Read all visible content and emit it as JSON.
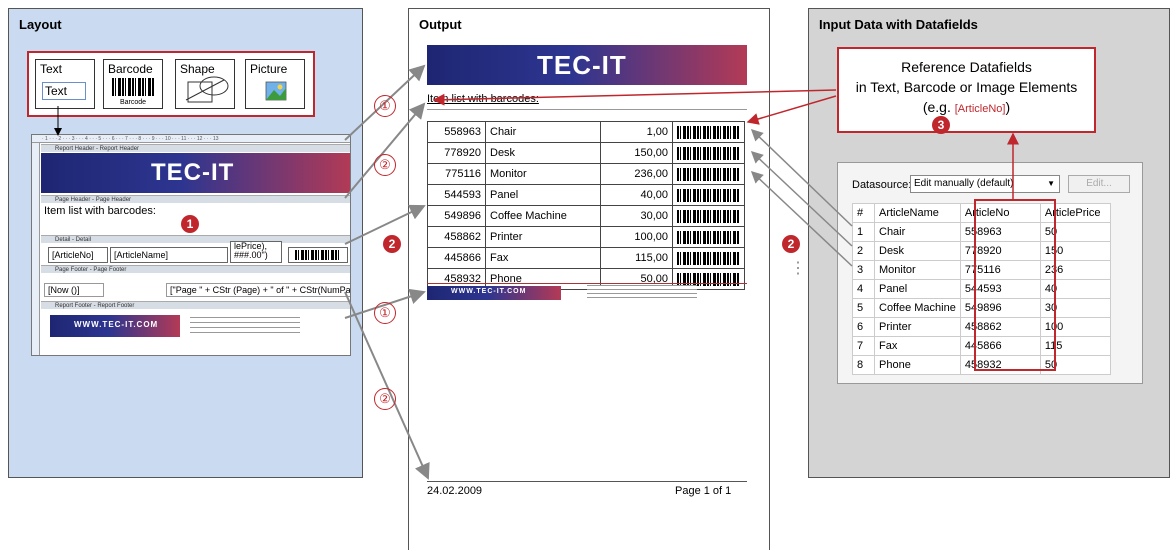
{
  "layout": {
    "title": "Layout",
    "tools": [
      {
        "label": "Text",
        "sample": "Text"
      },
      {
        "label": "Barcode",
        "sample": "Barcode"
      },
      {
        "label": "Shape"
      },
      {
        "label": "Picture"
      }
    ],
    "designer": {
      "ruler_text": "· 1 · · · 2 · · · 3 · · · 4 · · · 5 · · · 6 · · · 7 · · · 8 · · · 9 · · · 10 · · · 11 · · · 12 · · · 13",
      "sections": [
        "Report Header - Report Header",
        "Page Header - Page Header",
        "Detail - Detail",
        "Page Footer - Page Footer",
        "Report Footer - Report Footer"
      ],
      "banner_text": "TEC-IT",
      "heading": "Item list with barcodes:",
      "detail_fields": {
        "article_no": "[ArticleNo]",
        "article_name": "[ArticleName]",
        "price": "lePrice), ###.00\")"
      },
      "footer_left": "[Now ()]",
      "footer_right": "[\"Page \" + CStr (Page) + \" of \" + CStr(NumPages)]",
      "report_footer_text": "WWW.TEC-IT.COM"
    }
  },
  "output": {
    "title": "Output",
    "banner_text": "TEC-IT",
    "heading": "Item list with barcodes:",
    "rows": [
      {
        "no": "558963",
        "name": "Chair",
        "price": "1,00"
      },
      {
        "no": "778920",
        "name": "Desk",
        "price": "150,00"
      },
      {
        "no": "775116",
        "name": "Monitor",
        "price": "236,00"
      },
      {
        "no": "544593",
        "name": "Panel",
        "price": "40,00"
      },
      {
        "no": "549896",
        "name": "Coffee Machine",
        "price": "30,00"
      },
      {
        "no": "458862",
        "name": "Printer",
        "price": "100,00"
      },
      {
        "no": "445866",
        "name": "Fax",
        "price": "115,00"
      },
      {
        "no": "458932",
        "name": "Phone",
        "price": "50,00"
      }
    ],
    "footer_banner_text": "WWW.TEC-IT.COM",
    "date": "24.02.2009",
    "page": "Page 1 of 1"
  },
  "input": {
    "title": "Input Data with Datafields",
    "callout_line1": "Reference Datafields",
    "callout_line2": "in Text, Barcode or Image Elements",
    "callout_line3_pre": "(e.g. ",
    "callout_example": "[ArticleNo]",
    "callout_line3_post": ")",
    "datasource_label": "Datasource:",
    "datasource_value": "Edit manually (default)",
    "edit_button": "Edit...",
    "columns": [
      "#",
      "ArticleName",
      "ArticleNo",
      "ArticlePrice"
    ],
    "rows": [
      [
        "1",
        "Chair",
        "558963",
        "50"
      ],
      [
        "2",
        "Desk",
        "778920",
        "150"
      ],
      [
        "3",
        "Monitor",
        "775116",
        "236"
      ],
      [
        "4",
        "Panel",
        "544593",
        "40"
      ],
      [
        "5",
        "Coffee Machine",
        "549896",
        "30"
      ],
      [
        "6",
        "Printer",
        "458862",
        "100"
      ],
      [
        "7",
        "Fax",
        "445866",
        "115"
      ],
      [
        "8",
        "Phone",
        "458932",
        "50"
      ]
    ]
  },
  "markers": {
    "one": "1",
    "two": "2",
    "three": "3",
    "step1": "①",
    "step2": "②",
    "ellipsis": "⋮"
  },
  "colors": {
    "accent": "#c0272d",
    "layout_bg": "#c9daf1",
    "input_bg": "#d4d4d4",
    "banner": "#1e2673"
  }
}
